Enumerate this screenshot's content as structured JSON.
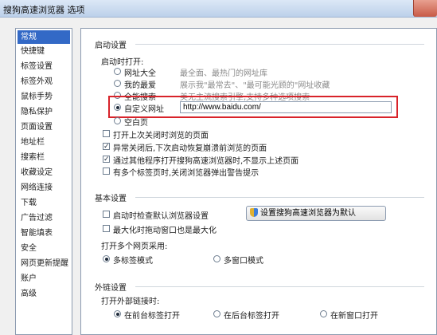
{
  "window": {
    "title": "搜狗高速浏览器 选项"
  },
  "sidebar": {
    "items": [
      {
        "label": "常规",
        "selected": true
      },
      {
        "label": "快捷键"
      },
      {
        "label": "标签设置"
      },
      {
        "label": "标签外观"
      },
      {
        "label": "鼠标手势"
      },
      {
        "label": "隐私保护"
      },
      {
        "label": "页面设置"
      },
      {
        "label": "地址栏"
      },
      {
        "label": "搜索栏"
      },
      {
        "label": "收藏设定"
      },
      {
        "label": "网络连接"
      },
      {
        "label": "下载"
      },
      {
        "label": "广告过滤"
      },
      {
        "label": "智能填表"
      },
      {
        "label": "安全"
      },
      {
        "label": "网页更新提醒"
      },
      {
        "label": "账户"
      },
      {
        "label": "高级"
      }
    ]
  },
  "startup": {
    "group_title": "启动设置",
    "open_label": "启动时打开:",
    "options": [
      {
        "label": "网址大全",
        "desc": "最全面、最热门的网址库",
        "checked": false
      },
      {
        "label": "我的最爱",
        "desc": "展示我\"最常去\"、\"最可能光顾的\"网址收藏",
        "checked": false
      },
      {
        "label": "全能搜索",
        "desc": "美无主流搜索引擎,支持多种选项搜索",
        "checked": false
      },
      {
        "label": "自定义网址",
        "checked": true
      },
      {
        "label": "空白页",
        "checked": false
      }
    ],
    "custom_url": "http://www.baidu.com/",
    "checkboxes": [
      {
        "label": "打开上次关闭时浏览的页面",
        "checked": false
      },
      {
        "label": "异常关闭后,下次启动恢复崩溃前浏览的页面",
        "checked": true
      },
      {
        "label": "通过其他程序打开搜狗高速浏览器时,不显示上述页面",
        "checked": true
      },
      {
        "label": "有多个标签页时,关闭浏览器弹出警告提示",
        "checked": false
      }
    ]
  },
  "basic": {
    "group_title": "基本设置",
    "check_default_label": "启动时检查默认浏览器设置",
    "set_default_button": "设置搜狗高速浏览器为默认",
    "minimize_label": "最大化时拖动窗口也是最大化",
    "multi_page_label": "打开多个网页采用:",
    "modes": [
      {
        "label": "多标签模式",
        "checked": true
      },
      {
        "label": "多窗口模式",
        "checked": false
      }
    ]
  },
  "external": {
    "group_title": "外链设置",
    "open_label": "打开外部链接时:",
    "options": [
      {
        "label": "在前台标签打开",
        "checked": true
      },
      {
        "label": "在后台标签打开",
        "checked": false
      },
      {
        "label": "在新窗口打开",
        "checked": false
      }
    ]
  },
  "colors": {
    "highlight": "#d8232a",
    "selection": "#3369c6"
  }
}
